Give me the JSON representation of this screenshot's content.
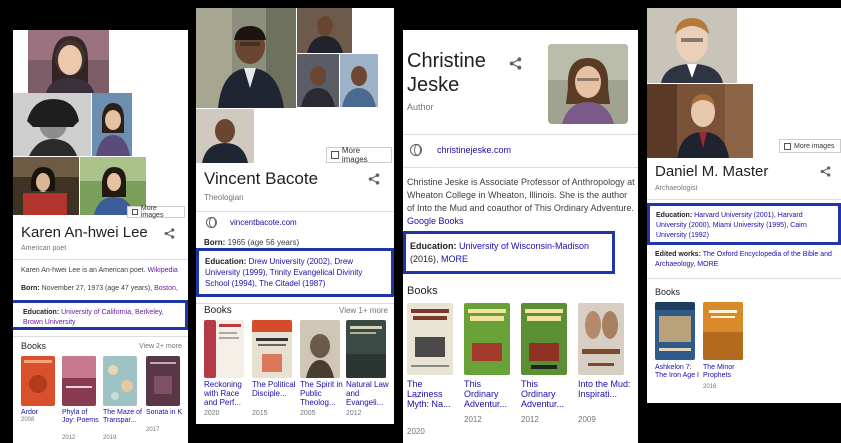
{
  "panels": [
    {
      "name": "Karen An-hwei Lee",
      "subtitle": "American poet",
      "more_images": "More images",
      "description": "Karen An-hwei Lee is an American poet.",
      "description_link": "Wikipedia",
      "born_label": "Born:",
      "born_value": "November 27, 1973 (age 47 years),",
      "born_link": "Boston,",
      "education_label": "Education:",
      "education_value": "University of California, Berkeley, Brown University",
      "books_label": "Books",
      "view_more": "View 2+ more",
      "books": [
        {
          "title": "Ardor",
          "year": "2008",
          "color": "#d9512c"
        },
        {
          "title": "Phyla of Joy: Poems",
          "year": "2012",
          "color": "#8a3a52"
        },
        {
          "title": "The Maze of Transpar...",
          "year": "2019",
          "color": "#9fc2c4"
        },
        {
          "title": "Sonata in K",
          "year": "2017",
          "color": "#5a3746"
        }
      ]
    },
    {
      "name": "Vincent Bacote",
      "subtitle": "Theologian",
      "more_images": "More images",
      "website": "vincentbacote.com",
      "born_label": "Born:",
      "born_value": "1965 (age 56 years)",
      "education_label": "Education:",
      "education_value": "Drew University (2002), Drew University (1999), Trinity Evangelical Divinity School (1994), The Citadel (1987)",
      "books_label": "Books",
      "view_more": "View 1+ more",
      "books": [
        {
          "title": "Reckoning with Race and Perf...",
          "year": "2020",
          "color": "#b63a46"
        },
        {
          "title": "The Political Disciple...",
          "year": "2015",
          "color": "#e8e0d0"
        },
        {
          "title": "The Spirit in Public Theolog...",
          "year": "2005",
          "color": "#cfc6b6"
        },
        {
          "title": "Natural Law and Evangeli...",
          "year": "2012",
          "color": "#3a4a44"
        }
      ]
    },
    {
      "name_line1": "Christine",
      "name_line2": "Jeske",
      "subtitle": "Author",
      "website": "christinejeske.com",
      "description": "Christine Jeske is Associate Professor of Anthropology at Wheaton College in Wheaton, Illinois. She is the author of Into the Mud and coauthor of This Ordinary Adventure.",
      "description_link": "Google Books",
      "education_label": "Education:",
      "education_link": "University of Wisconsin-Madison",
      "education_suffix": "(2016),",
      "education_more": "MORE",
      "books_label": "Books",
      "books": [
        {
          "title": "The Laziness Myth: Na...",
          "year": "2020",
          "color": "#e9e3d4"
        },
        {
          "title": "This Ordinary Adventur...",
          "year": "2012",
          "color": "#6aa23a"
        },
        {
          "title": "This Ordinary Adventur...",
          "year": "2012",
          "color": "#5b8f34"
        },
        {
          "title": "Into the Mud: Inspirati...",
          "year": "2009",
          "color": "#d7cfc3"
        }
      ]
    },
    {
      "name": "Daniel M. Master",
      "subtitle": "Archaeologist",
      "more_images": "More images",
      "education_label": "Education:",
      "education_value": "Harvard University (2001), Harvard University (2000), Miami University (1995), Cairn University (1992)",
      "edited_label": "Edited works:",
      "edited_value": "The Oxford Encyclopedia of the Bible and Archaeology,",
      "edited_more": "MORE",
      "books_label": "Books",
      "books": [
        {
          "title": "Ashkelon 7: The Iron Age I",
          "year": "",
          "color": "#2f5a8a"
        },
        {
          "title": "The Minor Prophets",
          "year": "2016",
          "color": "#d98a2a"
        }
      ]
    }
  ]
}
